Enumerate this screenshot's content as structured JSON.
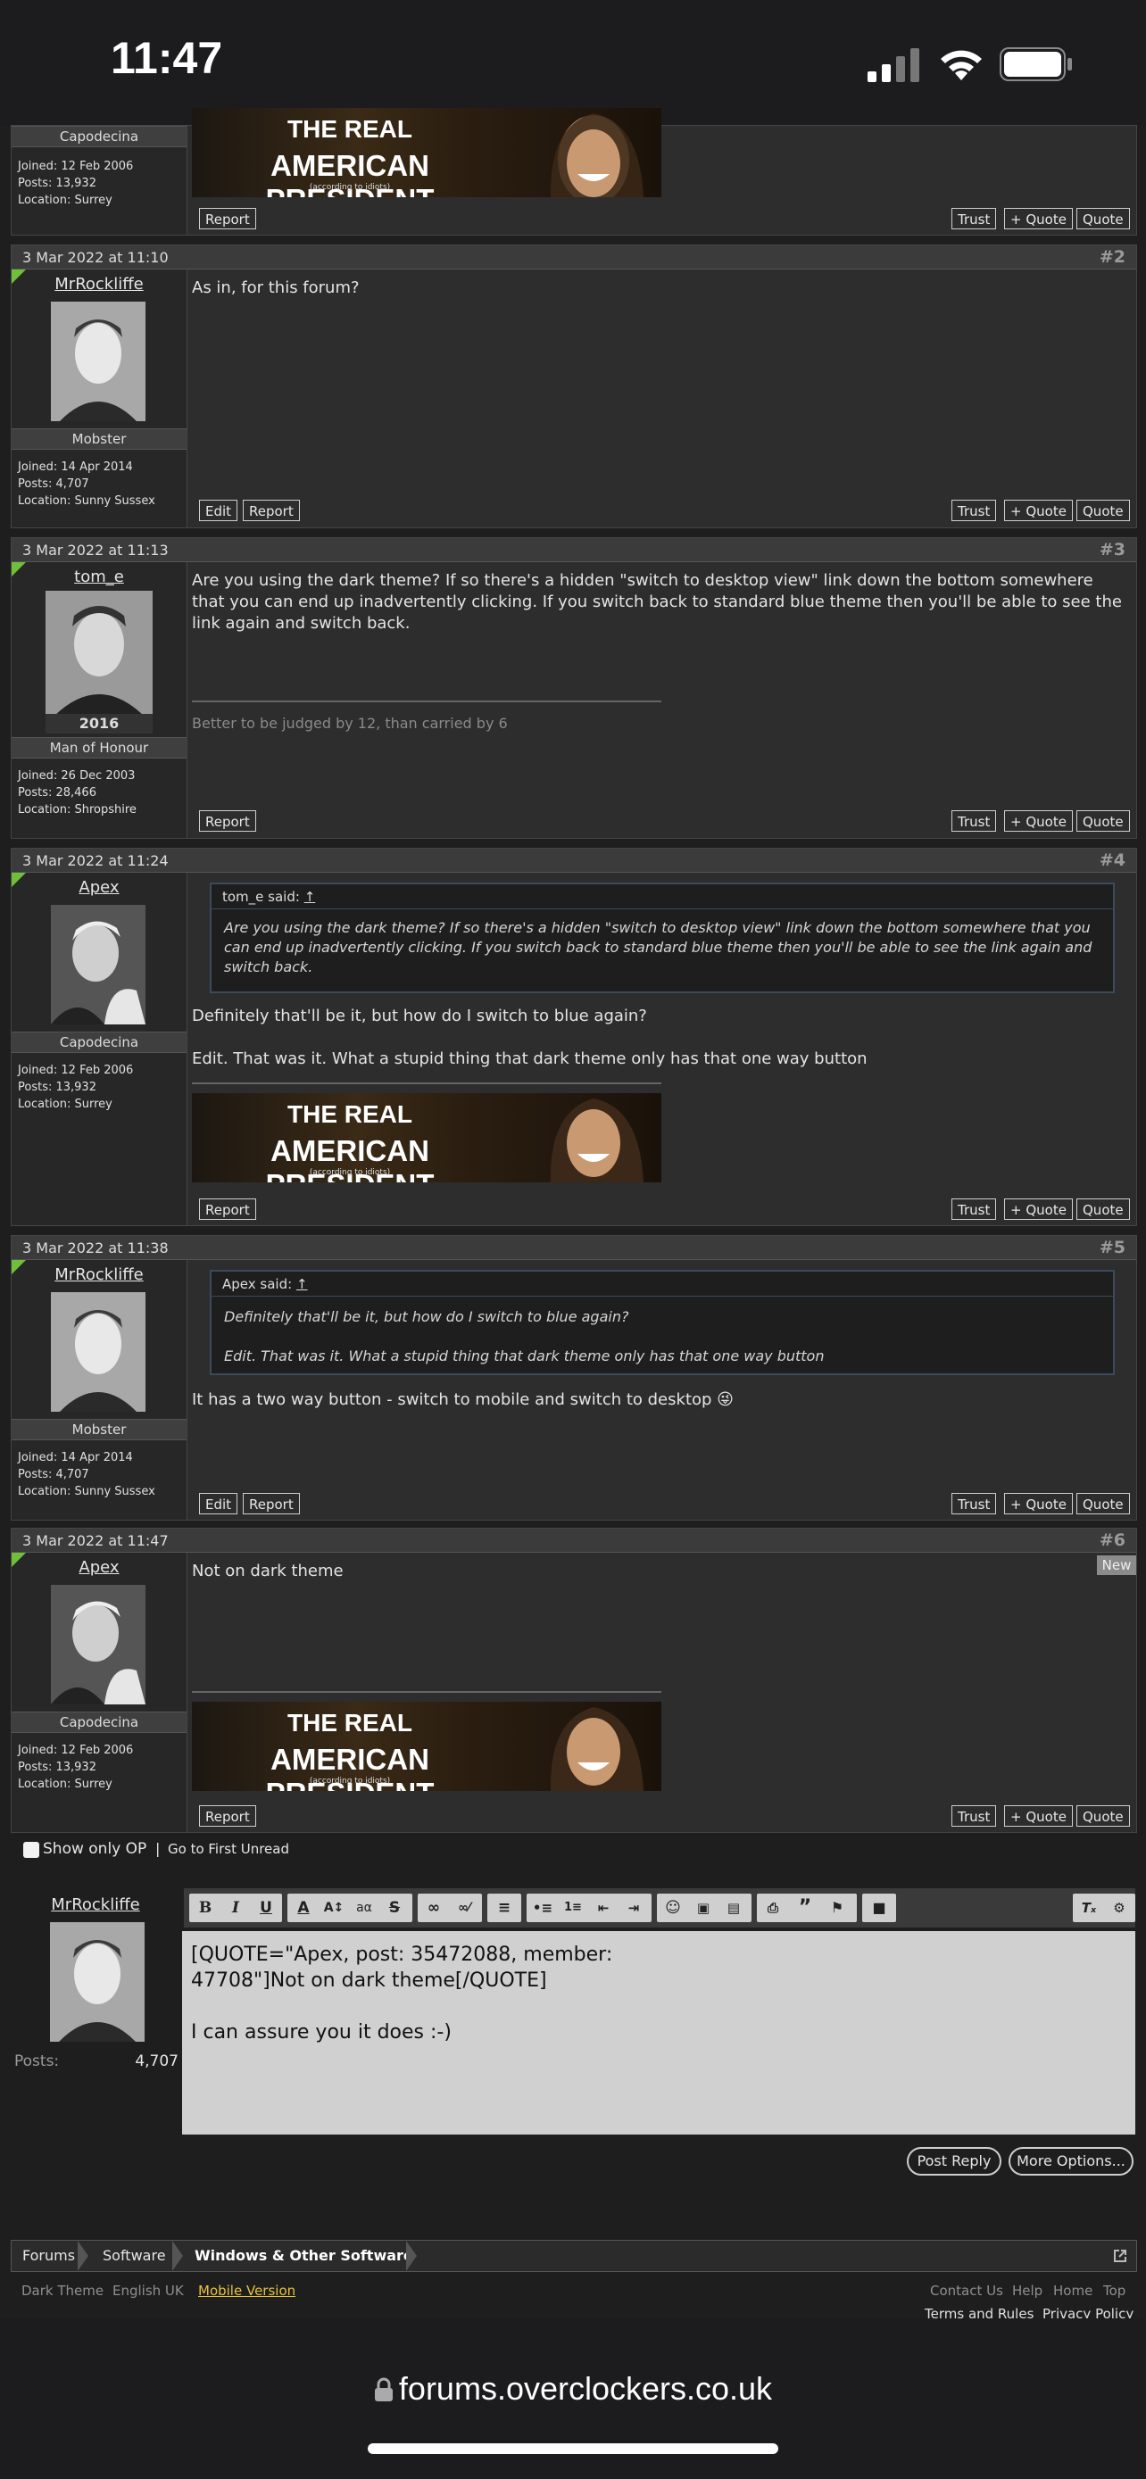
{
  "status_bar": {
    "time": "11:47"
  },
  "top_post": {
    "rank": "Capodecina",
    "meta": [
      "Joined: 12 Feb 2006",
      "Posts: 13,932",
      "Location: Surrey"
    ],
    "buttons": {
      "report": "Report",
      "trust": "Trust",
      "plus_quote": "+ Quote",
      "quote": "Quote"
    }
  },
  "banner": {
    "line1": "THE REAL",
    "line2": "AMERICAN PRESIDENT",
    "line3": "(according to idiots)"
  },
  "posts": [
    {
      "date": "3 Mar 2022 at 11:10",
      "number": "#2",
      "username": "MrRockliffe",
      "rank": "Mobster",
      "meta": [
        "Joined: 14 Apr 2014",
        "Posts: 4,707",
        "Location: Sunny Sussex"
      ],
      "message": "As in, for this forum?",
      "buttons": {
        "edit": "Edit",
        "report": "Report",
        "trust": "Trust",
        "plus_quote": "+ Quote",
        "quote": "Quote"
      }
    },
    {
      "date": "3 Mar 2022 at 11:13",
      "number": "#3",
      "username": "tom_e",
      "rank": "Man of Honour",
      "avatar_caption": "2016",
      "meta": [
        "Joined: 26 Dec 2003",
        "Posts: 28,466",
        "Location: Shropshire"
      ],
      "message": "Are you using the dark theme? If so there's a hidden \"switch to desktop view\" link down the bottom somewhere that you can end up inadvertently clicking. If you switch back to standard blue theme then you'll be able to see the link again and switch back.",
      "signature": "Better to be judged by 12, than carried by 6",
      "buttons": {
        "report": "Report",
        "trust": "Trust",
        "plus_quote": "+ Quote",
        "quote": "Quote"
      }
    },
    {
      "date": "3 Mar 2022 at 11:24",
      "number": "#4",
      "username": "Apex",
      "rank": "Capodecina",
      "meta": [
        "Joined: 12 Feb 2006",
        "Posts: 13,932",
        "Location: Surrey"
      ],
      "quote": {
        "author": "tom_e said:",
        "arrow": "↑",
        "text": "Are you using the dark theme? If so there's a hidden \"switch to desktop view\" link down the bottom somewhere that you can end up inadvertently clicking. If you switch back to standard blue theme then you'll be able to see the link again and switch back."
      },
      "message1": "Definitely that'll be it, but how do I switch to blue again?",
      "message2": "Edit. That was it. What a stupid thing that dark theme only has that one way button",
      "buttons": {
        "report": "Report",
        "trust": "Trust",
        "plus_quote": "+ Quote",
        "quote": "Quote"
      }
    },
    {
      "date": "3 Mar 2022 at 11:38",
      "number": "#5",
      "username": "MrRockliffe",
      "rank": "Mobster",
      "meta": [
        "Joined: 14 Apr 2014",
        "Posts: 4,707",
        "Location: Sunny Sussex"
      ],
      "quote": {
        "author": "Apex said:",
        "arrow": "↑",
        "line1": "Definitely that'll be it, but how do I switch to blue again?",
        "line2": "Edit. That was it. What a stupid thing that dark theme only has that one way button"
      },
      "message": "It has a two way button - switch to mobile and switch to desktop 😜",
      "buttons": {
        "edit": "Edit",
        "report": "Report",
        "trust": "Trust",
        "plus_quote": "+ Quote",
        "quote": "Quote"
      }
    },
    {
      "date": "3 Mar 2022 at 11:47",
      "number": "#6",
      "username": "Apex",
      "rank": "Capodecina",
      "meta": [
        "Joined: 12 Feb 2006",
        "Posts: 13,932",
        "Location: Surrey"
      ],
      "new_badge": "New",
      "message": "Not on dark theme",
      "buttons": {
        "report": "Report",
        "trust": "Trust",
        "plus_quote": "+ Quote",
        "quote": "Quote"
      }
    }
  ],
  "thread_tools": {
    "show_only_op": "Show only OP",
    "separator": "|",
    "go_to_first_unread": "Go to First Unread"
  },
  "reply": {
    "username": "MrRockliffe",
    "posts_label": "Posts:",
    "posts_value": "4,707",
    "editor_line1": "[QUOTE=\"Apex, post: 35472088, member:",
    "editor_line2": "47708\"]Not on dark theme[/QUOTE]",
    "editor_line3": "I can assure you it does :-)",
    "post_reply": "Post Reply",
    "more_options": "More Options..."
  },
  "breadcrumbs": [
    "Forums",
    "Software",
    "Windows & Other Software"
  ],
  "footer": {
    "dark_theme": "Dark Theme",
    "language": "English UK",
    "mobile_version": "Mobile Version",
    "contact_us": "Contact Us",
    "help": "Help",
    "home": "Home",
    "top": "Top",
    "terms": "Terms and Rules",
    "privacy": "Privacy Policy"
  },
  "browser": {
    "url": "forums.overclockers.co.uk"
  }
}
